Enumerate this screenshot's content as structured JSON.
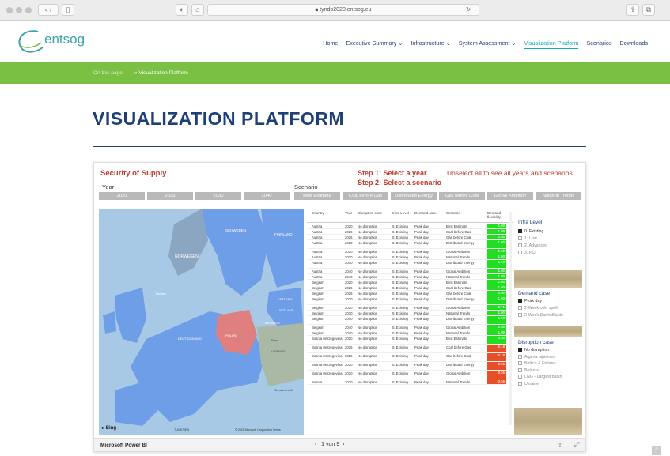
{
  "browser": {
    "url": "tyndp2020.entsog.eu"
  },
  "header": {
    "logo_text": "entsog",
    "nav": [
      "Home",
      "Executive Summary ⌄",
      "Infrastructure ⌄",
      "System Assessment ⌄",
      "Visualization Platform",
      "Scenarios",
      "Downloads"
    ],
    "active_nav": "Visualization Platform"
  },
  "breadcrumb": {
    "label": "On this page:",
    "item": "» Visualization Platform"
  },
  "page_title": "VISUALIZATION PLATFORM",
  "report": {
    "title": "Security of Supply",
    "step1": "Step 1: Select a year",
    "step2": "Step 2: Select a scenario",
    "hint": "Unselect all to see all years and scenarios",
    "year_label": "Year",
    "years": [
      "2020",
      "2025",
      "2030",
      "2040"
    ],
    "scenario_label": "Scenario",
    "scenarios": [
      "Best Estimate",
      "Coal before Gas",
      "Distributed Energy",
      "Gas before Coal",
      "Global Ambition",
      "National Trends"
    ],
    "map": {
      "highlight_country": "POLEN",
      "labels": [
        "NORWEGEN",
        "Norden",
        "SCHWEDEN",
        "FINNLAND",
        "ESTLAND",
        "LETTLAND",
        "BELARUS",
        "UKRAINE",
        "DEUTSCHLAND",
        "Schwarzes M.",
        "TUNESIEN",
        "Kiew"
      ],
      "bing": "Bing",
      "credit": "© 2021 Microsoft Corporation  Terms"
    },
    "table": {
      "columns": [
        "Country",
        "Year",
        "Disruption case",
        "Infra Level",
        "Demand case",
        "Scenario",
        "Demand flexibility"
      ],
      "rows": [
        [
          "Austria",
          "2020",
          "No disruption",
          "0. Existing",
          "Peak day",
          "Best Estimate",
          "1.00",
          "g"
        ],
        [
          "Austria",
          "2025",
          "No disruption",
          "0. Existing",
          "Peak day",
          "Coal before Gas",
          "1.00",
          "g"
        ],
        [
          "Austria",
          "2025",
          "No disruption",
          "0. Existing",
          "Peak day",
          "Gas before Coal",
          "1.00",
          "g"
        ],
        [
          "Austria",
          "2030",
          "No disruption",
          "0. Existing",
          "Peak day",
          "Distributed Energy",
          "1.00",
          "g"
        ],
        [
          "Austria",
          "2030",
          "No disruption",
          "0. Existing",
          "Peak day",
          "Global Ambition",
          "1.00",
          "g"
        ],
        [
          "Austria",
          "2030",
          "No disruption",
          "0. Existing",
          "Peak day",
          "National Trends",
          "1.00",
          "g"
        ],
        [
          "Austria",
          "2040",
          "No disruption",
          "0. Existing",
          "Peak day",
          "Distributed Energy",
          "1.00",
          "g"
        ],
        [
          "Austria",
          "2040",
          "No disruption",
          "0. Existing",
          "Peak day",
          "Global Ambition",
          "1.00",
          "g"
        ],
        [
          "Austria",
          "2040",
          "No disruption",
          "0. Existing",
          "Peak day",
          "National Trends",
          "1.00",
          "g"
        ],
        [
          "Belgium",
          "2020",
          "No disruption",
          "0. Existing",
          "Peak day",
          "Best Estimate",
          "1.00",
          "g"
        ],
        [
          "Belgium",
          "2025",
          "No disruption",
          "0. Existing",
          "Peak day",
          "Coal before Gas",
          "1.00",
          "g"
        ],
        [
          "Belgium",
          "2025",
          "No disruption",
          "0. Existing",
          "Peak day",
          "Gas before Coal",
          "1.00",
          "g"
        ],
        [
          "Belgium",
          "2030",
          "No disruption",
          "0. Existing",
          "Peak day",
          "Distributed Energy",
          "1.00",
          "g"
        ],
        [
          "Belgium",
          "2030",
          "No disruption",
          "0. Existing",
          "Peak day",
          "Global Ambition",
          "0.71",
          "g"
        ],
        [
          "Belgium",
          "2030",
          "No disruption",
          "0. Existing",
          "Peak day",
          "National Trends",
          "1.00",
          "g"
        ],
        [
          "Belgium",
          "2040",
          "No disruption",
          "0. Existing",
          "Peak day",
          "Distributed Energy",
          "1.00",
          "g"
        ],
        [
          "Belgium",
          "2040",
          "No disruption",
          "0. Existing",
          "Peak day",
          "Global Ambition",
          "1.00",
          "g"
        ],
        [
          "Belgium",
          "2040",
          "No disruption",
          "0. Existing",
          "Peak day",
          "National Trends",
          "1.00",
          "g"
        ],
        [
          "Bosnia Herzegovina",
          "2020",
          "No disruption",
          "0. Existing",
          "Peak day",
          "Best Estimate",
          "0.40",
          "g"
        ],
        [
          "Bosnia Herzegovina",
          "2025",
          "No disruption",
          "0. Existing",
          "Peak day",
          "Coal before Gas",
          "-0.18",
          "r"
        ],
        [
          "Bosnia Herzegovina",
          "2025",
          "No disruption",
          "0. Existing",
          "Peak day",
          "Gas before Coal",
          "-0.18",
          "r"
        ],
        [
          "Bosnia Herzegovina",
          "2030",
          "No disruption",
          "0. Existing",
          "Peak day",
          "Distributed Energy",
          "-0.56",
          "r"
        ],
        [
          "Bosnia Herzegovina",
          "2030",
          "No disruption",
          "0. Existing",
          "Peak day",
          "Global Ambition",
          "-0.56",
          "r"
        ],
        [
          "Bosnia",
          "2030",
          "No disruption",
          "0. Existing",
          "Peak day",
          "National Trends",
          "-0.56",
          "r"
        ]
      ]
    },
    "infra_level": {
      "title": "Infra Level",
      "options": [
        {
          "label": "0. Existing",
          "selected": true
        },
        {
          "label": "1. Low",
          "selected": false
        },
        {
          "label": "2. Advanced",
          "selected": false
        },
        {
          "label": "3. PCI",
          "selected": false
        }
      ]
    },
    "demand_case": {
      "title": "Demand case",
      "options": [
        {
          "label": "Peak day",
          "selected": true
        },
        {
          "label": "2-Week cold spell",
          "selected": false
        },
        {
          "label": "2-Week Dunkelflaute",
          "selected": false
        }
      ]
    },
    "disruption_case": {
      "title": "Disruption case",
      "options": [
        {
          "label": "No disruption",
          "selected": true
        },
        {
          "label": "Algeria pipelines",
          "selected": false
        },
        {
          "label": "Baltics & Finland",
          "selected": false
        },
        {
          "label": "Belarus",
          "selected": false
        },
        {
          "label": "LNG - Largest basin",
          "selected": false
        },
        {
          "label": "Ukraine",
          "selected": false
        }
      ]
    },
    "footer": {
      "brand": "Microsoft Power BI",
      "pager": "1 von 9"
    }
  },
  "colors": {
    "navy": "#1f3f78",
    "teal": "#17aab2",
    "green_bar": "#7ac043",
    "report_red": "#c0392b",
    "flex_green": "#22dd22",
    "flex_red": "#e5502a",
    "map_blue": "#6f9ee9",
    "map_poland": "#e07f7f"
  }
}
